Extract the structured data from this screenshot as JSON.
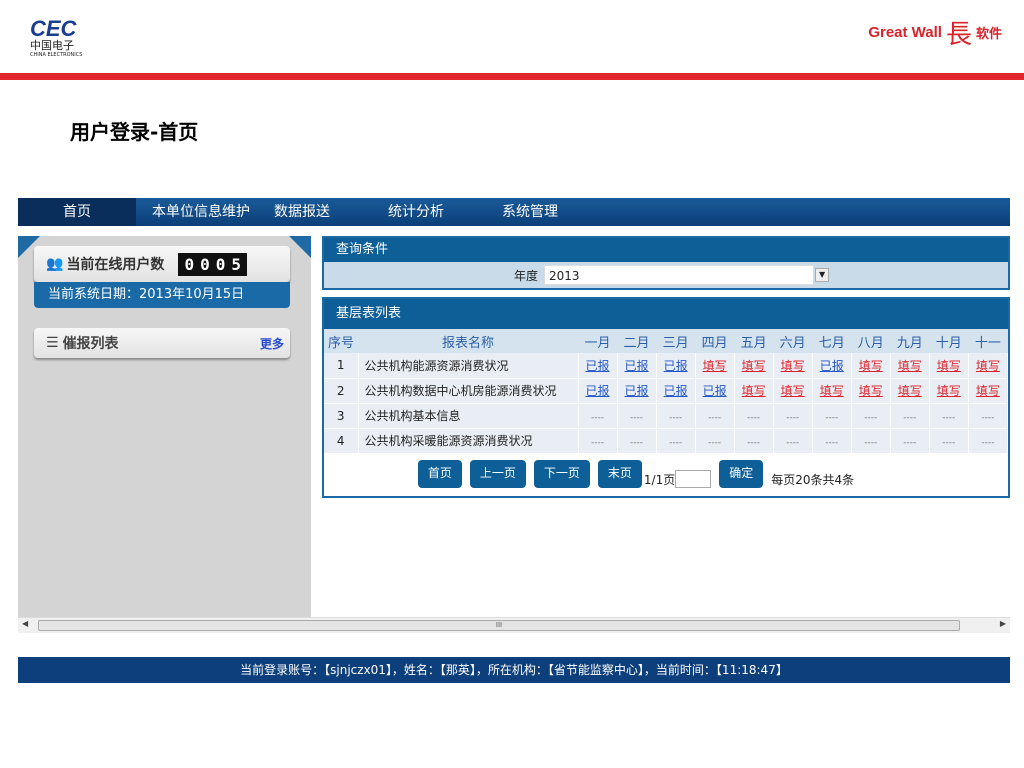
{
  "header": {
    "left_logo_main": "CEC",
    "left_logo_cn": "中国电子",
    "left_logo_en": "CHINA ELECTRONICS",
    "right_logo_en": "Great Wall",
    "right_logo_char": "长城",
    "right_logo_cn": "软件"
  },
  "page_title": "用户登录-首页",
  "nav": [
    "首页",
    "本单位信息维护",
    "数据报送",
    "统计分析",
    "系统管理"
  ],
  "left": {
    "online_label": "当前在线用户数",
    "online_digits": [
      "0",
      "0",
      "0",
      "5"
    ],
    "date_text": "当前系统日期：2013年10月15日",
    "remind_title": "催报列表",
    "more": "更多"
  },
  "query": {
    "title": "查询条件",
    "year_label": "年度",
    "year_value": "2013"
  },
  "list": {
    "title": "基层表列表",
    "columns": [
      "序号",
      "报表名称",
      "一月",
      "二月",
      "三月",
      "四月",
      "五月",
      "六月",
      "七月",
      "八月",
      "九月",
      "十月",
      "十一"
    ],
    "rows": [
      {
        "no": "1",
        "name": "公共机构能源资源消费状况",
        "cells": [
          "已报",
          "已报",
          "已报",
          "填写",
          "填写",
          "填写",
          "已报",
          "填写",
          "填写",
          "填写",
          "填写"
        ]
      },
      {
        "no": "2",
        "name": "公共机构数据中心机房能源消费状况",
        "cells": [
          "已报",
          "已报",
          "已报",
          "已报",
          "填写",
          "填写",
          "填写",
          "填写",
          "填写",
          "填写",
          "填写"
        ]
      },
      {
        "no": "3",
        "name": "公共机构基本信息",
        "cells": [
          "----",
          "----",
          "----",
          "----",
          "----",
          "----",
          "----",
          "----",
          "----",
          "----",
          "----"
        ]
      },
      {
        "no": "4",
        "name": "公共机构采暖能源资源消费状况",
        "cells": [
          "----",
          "----",
          "----",
          "----",
          "----",
          "----",
          "----",
          "----",
          "----",
          "----",
          "----"
        ]
      }
    ],
    "pager": {
      "first": "首页",
      "prev": "上一页",
      "next": "下一页",
      "last": "末页",
      "page": "1/1页",
      "confirm": "确定",
      "summary": "每页20条共4条"
    }
  },
  "scrollbar": {
    "thumb_label": "III"
  },
  "footer": "当前登录账号：【sjnjczx01】，姓名：【那英】，所在机构：【省节能监察中心】，当前时间：【11:18:47】"
}
